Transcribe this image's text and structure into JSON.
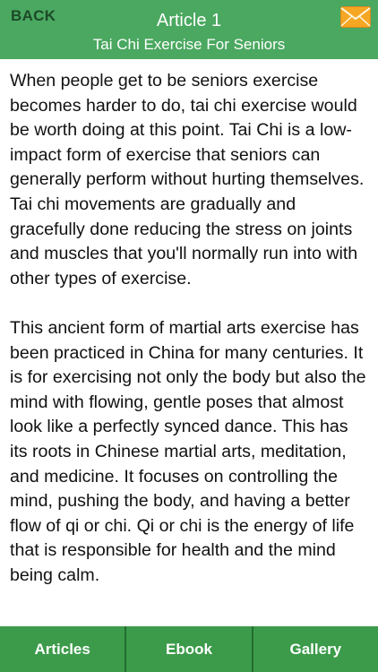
{
  "header": {
    "back_label": "BACK",
    "title": "Article 1",
    "subtitle": "Tai Chi Exercise For Seniors",
    "mail_icon": "envelope-icon",
    "background_color": "#4aa860",
    "mail_color": "#f5a623"
  },
  "article": {
    "paragraphs": [
      "When people get to be seniors exercise becomes harder to do, tai chi exercise would be worth doing at this point. Tai Chi is a low-impact form of exercise that seniors can generally perform without hurting themselves. Tai chi movements are gradually and gracefully done reducing the stress on joints and muscles that you'll normally run into with other types of exercise.",
      "This ancient form of martial arts exercise has been practiced in China for many centuries. It is for exercising not only the body but also the mind with flowing, gentle poses that almost look like a perfectly synced dance. This has its roots in Chinese martial arts, meditation, and medicine. It focuses on controlling the mind, pushing the body, and having a better flow of qi or chi. Qi or chi is the energy of life that is responsible for health and the mind being calm."
    ]
  },
  "tabs": [
    {
      "label": "Articles"
    },
    {
      "label": "Ebook"
    },
    {
      "label": "Gallery"
    }
  ],
  "colors": {
    "tab_background": "#3c9b4a",
    "tab_divider": "#216e30"
  }
}
